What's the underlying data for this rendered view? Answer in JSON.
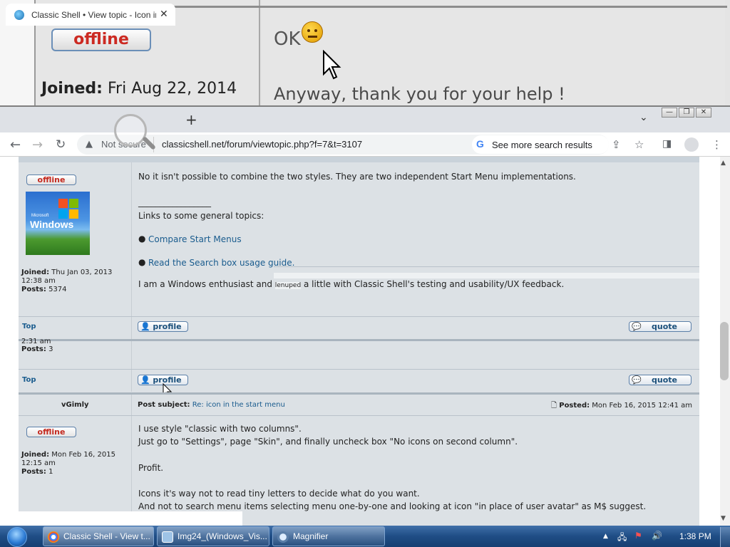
{
  "magnifier": {
    "offline_label": "offline",
    "joined_label": "Joined:",
    "joined_date": "Fri Aug 22, 2014",
    "ok_text": "OK",
    "thanks_text": "Anyway, thank you for your help !"
  },
  "browser": {
    "tab_title": "Classic Shell • View topic - Icon in the",
    "tab_close": "✕",
    "new_tab": "+",
    "tab_menu": "⌄",
    "window_controls": [
      "—",
      "❐",
      "✕"
    ],
    "security_text": "Not secure",
    "url": "classicshell.net/forum/viewtopic.php?f=7&t=3107",
    "google_side_text": "See more search results"
  },
  "post1": {
    "offline_label": "offline",
    "avatar_brand": "Microsoft",
    "avatar_text": "Windows",
    "joined_label": "Joined:",
    "joined_value": "Thu Jan 03, 2013",
    "joined_time": "12:38 am",
    "posts_label": "Posts:",
    "posts_value": "5374",
    "body_line1": "No it isn't possible to combine the two styles. They are two independent Start Menu implementations.",
    "signature_rule": "_________________",
    "links_intro": "Links to some general topics:",
    "link1": "Compare Start Menus",
    "link2": "Read the Search box usage guide.",
    "enthusiast_pre": "I am a Windows enthusiast and ",
    "enthusiast_fragment": "lenuped",
    "enthusiast_post": " a little with Classic Shell's testing and usability/UX feedback.",
    "top_link": "Top",
    "profile_button": "profile",
    "quote_button": "quote"
  },
  "post2": {
    "partial_time": "2:31 am",
    "posts_label": "Posts:",
    "posts_value": "3",
    "top_link": "Top",
    "profile_button": "profile",
    "quote_button": "quote"
  },
  "post3": {
    "author": "vGimly",
    "subject_label": "Post subject:",
    "subject": "Re: icon in the start menu",
    "posted_label": "Posted:",
    "posted_value": "Mon Feb 16, 2015 12:41 am",
    "offline_label": "offline",
    "joined_label": "Joined:",
    "joined_value": "Mon Feb 16, 2015",
    "joined_time": "12:15 am",
    "posts_label": "Posts:",
    "posts_value": "1",
    "line1": "I use style \"classic with two columns\".",
    "line2": "Just go to \"Settings\", page \"Skin\", and finally uncheck box \"No icons on second column\".",
    "line3": "Profit.",
    "line4": "Icons it's way not to read tiny letters to decide what do you want.",
    "line5": "And not to search menu items selecting menu one-by-one and looking at icon \"in place of user avatar\" as M$ suggest."
  },
  "taskbar": {
    "items": [
      {
        "label": "Classic Shell - View t..."
      },
      {
        "label": "Img24_(Windows_Vis..."
      },
      {
        "label": "Magnifier"
      }
    ],
    "clock": "1:38 PM"
  },
  "colors": {
    "post_bg": "#dce1e5",
    "link": "#1a5c8e",
    "offline": "#c3291f",
    "taskbar": "#1f4d85"
  }
}
